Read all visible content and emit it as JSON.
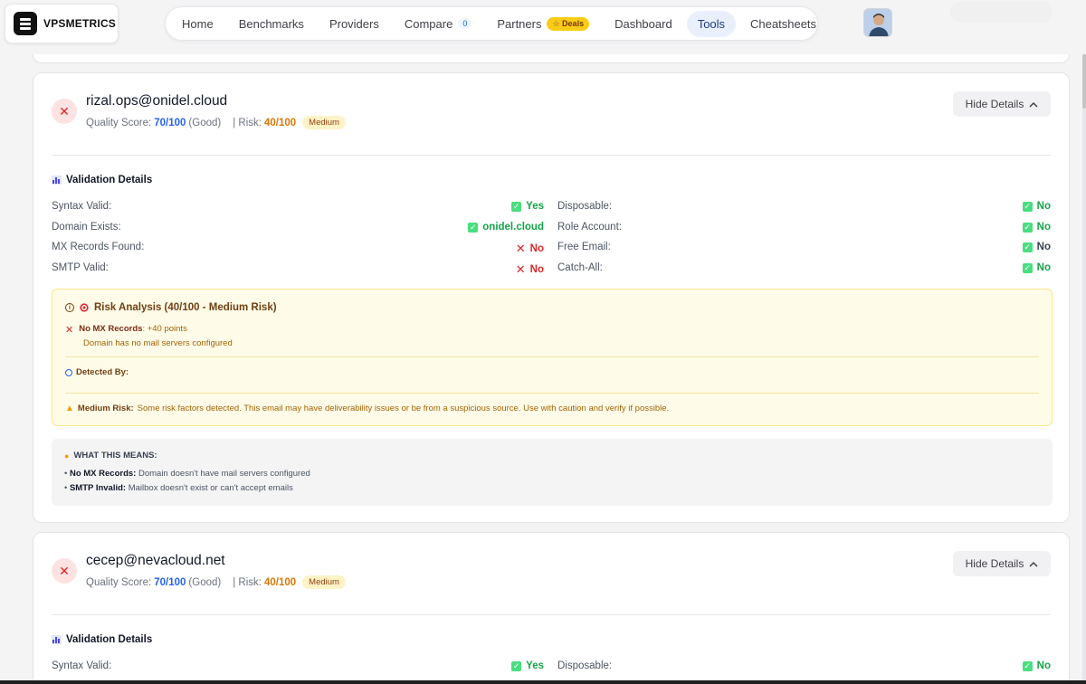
{
  "header": {
    "logo_text": "VPSMETRICS",
    "nav": [
      {
        "label": "Home"
      },
      {
        "label": "Benchmarks"
      },
      {
        "label": "Providers"
      },
      {
        "label": "Compare",
        "count": "0"
      },
      {
        "label": "Partners",
        "badge": "☆ Deals"
      },
      {
        "label": "Dashboard"
      },
      {
        "label": "Tools",
        "active": true
      },
      {
        "label": "Cheatsheets"
      }
    ]
  },
  "labels": {
    "quality_score": "Quality Score:",
    "risk": "| Risk:",
    "hide_details": "Hide Details",
    "validation_details": "Validation Details",
    "syntax_valid": "Syntax Valid:",
    "domain_exists": "Domain Exists:",
    "mx_records_found": "MX Records Found:",
    "smtp_valid": "SMTP Valid:",
    "disposable": "Disposable:",
    "role_account": "Role Account:",
    "free_email": "Free Email:",
    "catch_all": "Catch-All:"
  },
  "results": [
    {
      "email": "rizal.ops@onidel.cloud",
      "score": "70/100",
      "score_label": "(Good)",
      "risk_score": "40/100",
      "risk_level": "Medium",
      "validation": {
        "syntax_valid": "Yes",
        "domain_exists": "onidel.cloud",
        "mx_records_found": "No",
        "smtp_valid": "No",
        "disposable": "No",
        "role_account": "No",
        "free_email": "No",
        "catch_all": "No"
      },
      "risk_analysis": {
        "title": "Risk Analysis (40/100 - Medium Risk)",
        "factor_name": "No MX Records",
        "factor_points": ": +40 points",
        "factor_desc": "Domain has no mail servers configured",
        "detected_by": "Detected By:",
        "note_label": "Medium Risk:",
        "note_text": "Some risk factors detected. This email may have deliverability issues or be from a suspicious source. Use with caution and verify if possible."
      },
      "what_this_means": {
        "title": "WHAT THIS MEANS:",
        "items": [
          {
            "term": "No MX Records:",
            "desc": "Domain doesn't have mail servers configured"
          },
          {
            "term": "SMTP Invalid:",
            "desc": "Mailbox doesn't exist or can't accept emails"
          }
        ]
      }
    },
    {
      "email": "cecep@nevacloud.net",
      "score": "70/100",
      "score_label": "(Good)",
      "risk_score": "40/100",
      "risk_level": "Medium",
      "validation": {
        "syntax_valid": "Yes",
        "disposable": "No"
      }
    }
  ],
  "colors": {
    "ok": "#16a34a",
    "bad": "#dc2626",
    "score": "#2563eb",
    "risk": "#d97706",
    "active_tab": "#eaf0fb"
  },
  "icons": {
    "logo": "stack-icon",
    "status": "close-icon",
    "toggle": "chevron-up-icon",
    "valid": "check-icon",
    "invalid": "cross-icon",
    "details": "bar-chart-icon",
    "info": "info-icon",
    "risk": "target-icon",
    "detected": "magnifier-icon",
    "warning": "warning-icon",
    "tip": "lightbulb-icon"
  }
}
